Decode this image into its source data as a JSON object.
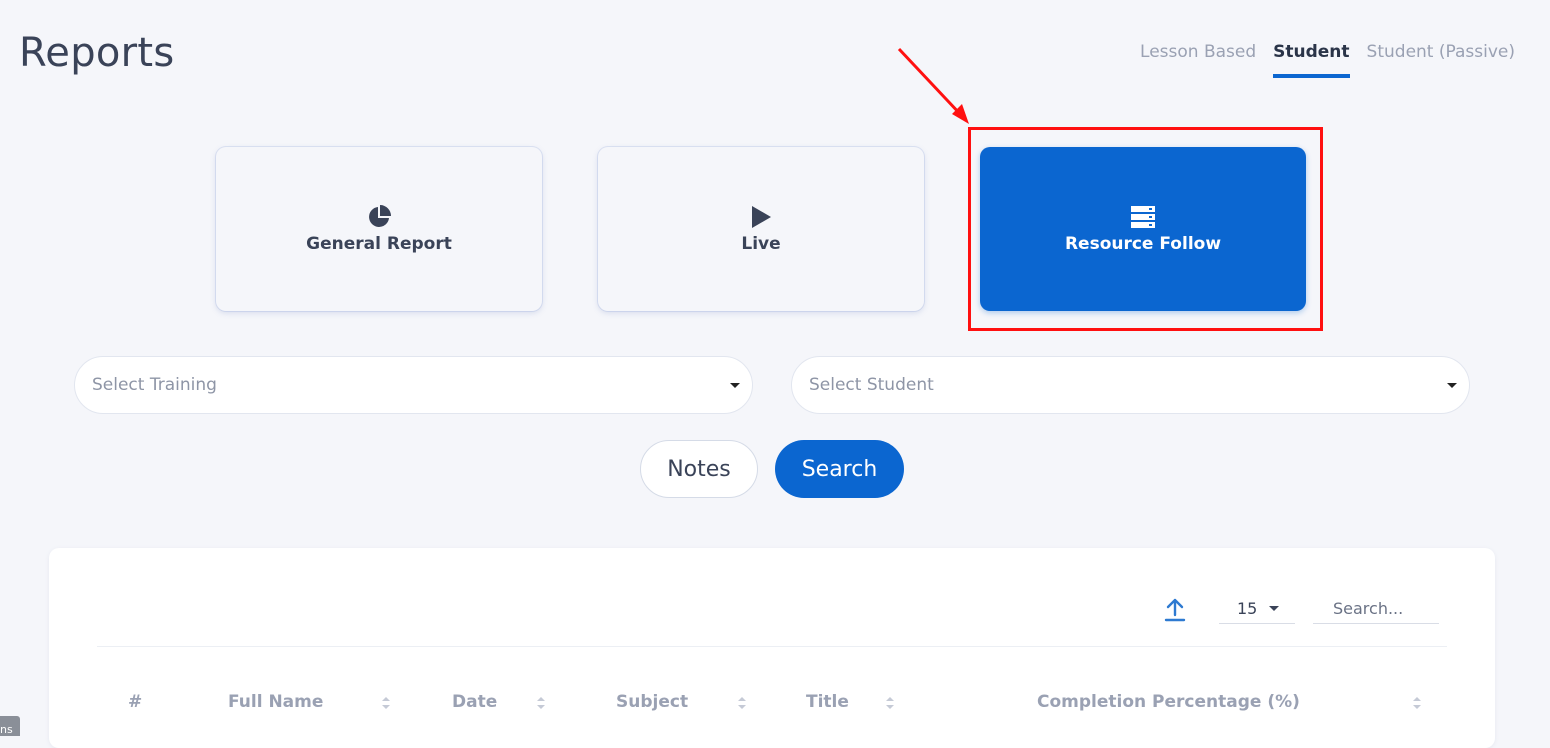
{
  "page": {
    "title": "Reports"
  },
  "tabs": [
    {
      "label": "Lesson Based",
      "active": false
    },
    {
      "label": "Student",
      "active": true
    },
    {
      "label": "Student (Passive)",
      "active": false
    }
  ],
  "cards": [
    {
      "label": "General Report",
      "icon": "pie-chart-icon",
      "active": false
    },
    {
      "label": "Live",
      "icon": "play-icon",
      "active": false
    },
    {
      "label": "Resource Follow",
      "icon": "server-icon",
      "active": true
    }
  ],
  "filters": {
    "training_placeholder": "Select Training",
    "student_placeholder": "Select Student"
  },
  "buttons": {
    "notes": "Notes",
    "search": "Search"
  },
  "table": {
    "page_size": "15",
    "search_placeholder": "Search...",
    "columns": [
      "#",
      "Full Name",
      "Date",
      "Subject",
      "Title",
      "Completion Percentage (%)"
    ]
  },
  "annotation": {
    "highlight_color": "#ff1010",
    "accent_color": "#0b66d0"
  },
  "corner_tag": "ns"
}
